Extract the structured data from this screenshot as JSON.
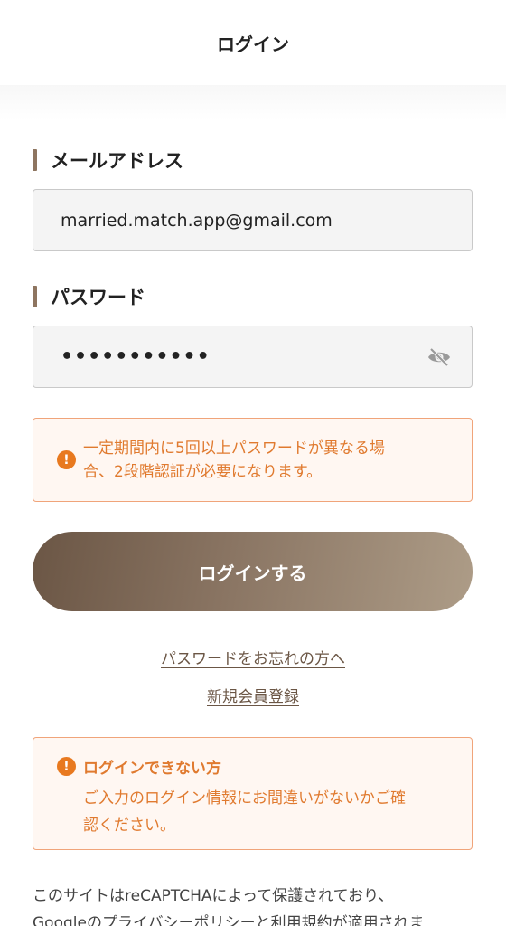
{
  "header": {
    "title": "ログイン"
  },
  "email": {
    "label": "メールアドレス",
    "value": "married.match.app@gmail.com"
  },
  "password": {
    "label": "パスワード",
    "value_masked": "•••••••••••",
    "toggle_icon": "eye-off-icon"
  },
  "warning": {
    "icon": "exclamation-icon",
    "line1": "一定期間内に5回以上パスワードが異なる場",
    "line2": "合、2段階認証が必要になります。"
  },
  "login_button": {
    "label": "ログインする"
  },
  "links": {
    "forgot_password": "パスワードをお忘れの方へ",
    "register": "新規会員登録"
  },
  "help": {
    "icon": "exclamation-icon",
    "title": "ログインできない方",
    "line1": "ご入力のログイン情報にお間違いがないかご確",
    "line2": "認ください。"
  },
  "footer": {
    "line1": "このサイトはreCAPTCHAによって保護されており、",
    "line2": "Googleのプライバシーポリシーと利用規約が適用されま"
  },
  "colors": {
    "accent": "#8e7560",
    "warning": "#e8791f",
    "warning_bg": "#fff7f2",
    "button_start": "#6b5645",
    "button_end": "#ad9c87"
  }
}
